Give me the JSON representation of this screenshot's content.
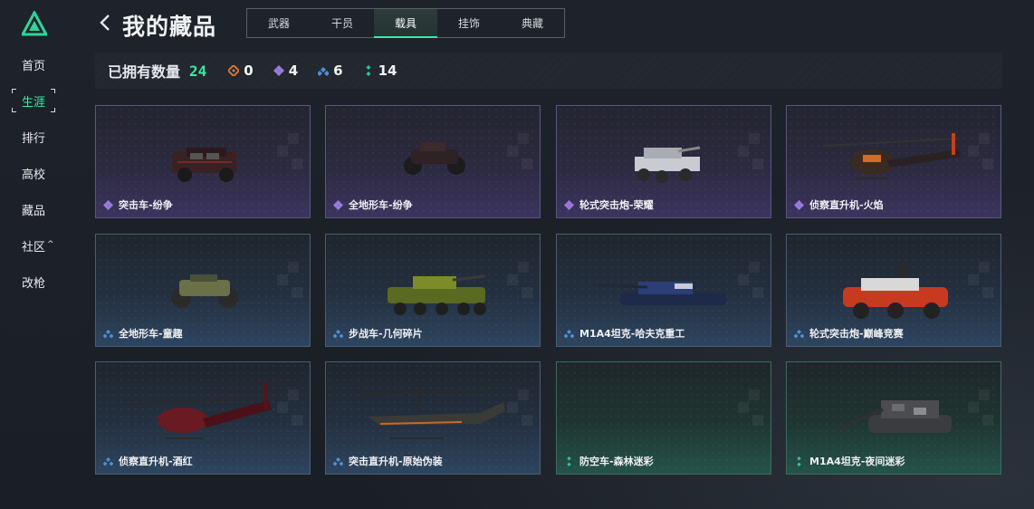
{
  "sidebar": {
    "items": [
      {
        "label": "首页"
      },
      {
        "label": "生涯",
        "active": true
      },
      {
        "label": "排行"
      },
      {
        "label": "高校"
      },
      {
        "label": "藏品"
      },
      {
        "label": "社区",
        "caret": "^"
      },
      {
        "label": "改枪"
      }
    ]
  },
  "header": {
    "title": "我的藏品",
    "tabs": [
      "武器",
      "干员",
      "载具",
      "挂饰",
      "典藏"
    ],
    "active_tab": "载具"
  },
  "owned": {
    "label": "已拥有数量",
    "total": "24",
    "rarities": [
      {
        "name": "gold",
        "color": "#d9733a",
        "count": "0"
      },
      {
        "name": "purple",
        "color": "#9b7ae0",
        "count": "4"
      },
      {
        "name": "blue",
        "color": "#4e8fd6",
        "count": "6"
      },
      {
        "name": "green",
        "color": "#2fc79a",
        "count": "14"
      }
    ]
  },
  "cards": [
    {
      "label": "突击车-纷争",
      "rarity": "purple"
    },
    {
      "label": "全地形车-纷争",
      "rarity": "purple"
    },
    {
      "label": "轮式突击炮-荣耀",
      "rarity": "purple"
    },
    {
      "label": "侦察直升机-火焰",
      "rarity": "purple"
    },
    {
      "label": "全地形车-童趣",
      "rarity": "blue"
    },
    {
      "label": "步战车-几何碎片",
      "rarity": "blue"
    },
    {
      "label": "M1A4坦克-哈夫克重工",
      "rarity": "blue"
    },
    {
      "label": "轮式突击炮-巅峰竞赛",
      "rarity": "blue"
    },
    {
      "label": "侦察直升机-酒红",
      "rarity": "blue"
    },
    {
      "label": "突击直升机-原始伪装",
      "rarity": "blue"
    },
    {
      "label": "防空车-森林迷彩",
      "rarity": "green"
    },
    {
      "label": "M1A4坦克-夜间迷彩",
      "rarity": "green"
    }
  ]
}
